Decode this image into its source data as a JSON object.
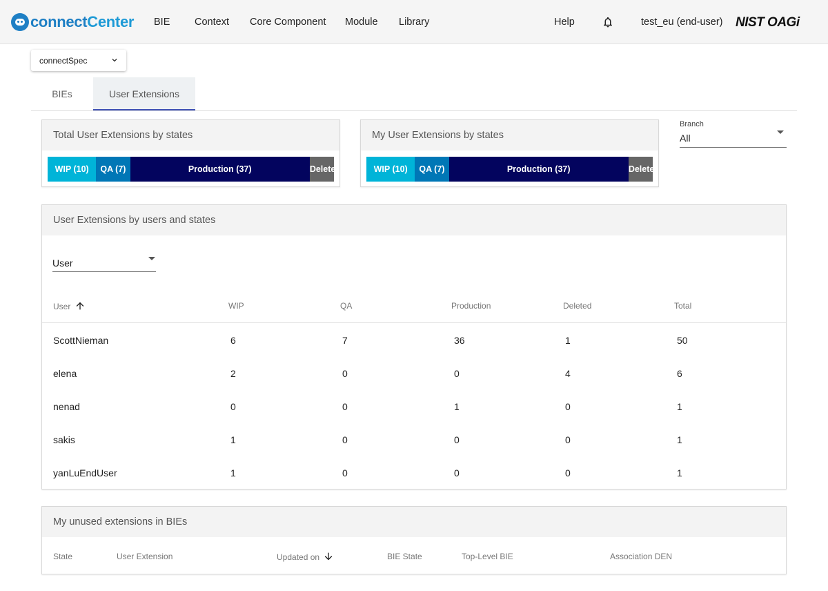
{
  "brand": {
    "part1": "connect",
    "part2": "Center"
  },
  "nav": {
    "items": [
      "BIE",
      "Context",
      "Core Component",
      "Module",
      "Library"
    ],
    "help": "Help",
    "user": "test_eu (end-user)",
    "org_logo": "NIST OAGi"
  },
  "spec_select": {
    "value": "connectSpec"
  },
  "tabs": [
    {
      "label": "BIEs",
      "active": false
    },
    {
      "label": "User Extensions",
      "active": true
    }
  ],
  "total_card": {
    "title": "Total User Extensions by states",
    "segments": [
      {
        "label": "WIP (10)",
        "value": 10,
        "color": "#00b4d8"
      },
      {
        "label": "QA (7)",
        "value": 7,
        "color": "#0077b6"
      },
      {
        "label": "Production (37)",
        "value": 37,
        "color": "#03045e"
      },
      {
        "label": "Deleted",
        "value": 5,
        "color": "#666666"
      }
    ]
  },
  "my_card": {
    "title": "My User Extensions by states",
    "segments": [
      {
        "label": "WIP (10)",
        "value": 10,
        "color": "#00b4d8"
      },
      {
        "label": "QA (7)",
        "value": 7,
        "color": "#0077b6"
      },
      {
        "label": "Production (37)",
        "value": 37,
        "color": "#03045e"
      },
      {
        "label": "Deleted",
        "value": 5,
        "color": "#666666"
      }
    ]
  },
  "branch": {
    "label": "Branch",
    "value": "All"
  },
  "users_card": {
    "title": "User Extensions by users and states",
    "filter_value": "User",
    "columns": [
      "User",
      "WIP",
      "QA",
      "Production",
      "Deleted",
      "Total"
    ],
    "rows": [
      [
        "ScottNieman",
        "6",
        "7",
        "36",
        "1",
        "50"
      ],
      [
        "elena",
        "2",
        "0",
        "0",
        "4",
        "6"
      ],
      [
        "nenad",
        "0",
        "0",
        "1",
        "0",
        "1"
      ],
      [
        "sakis",
        "1",
        "0",
        "0",
        "0",
        "1"
      ],
      [
        "yanLuEndUser",
        "1",
        "0",
        "0",
        "0",
        "1"
      ]
    ]
  },
  "unused_card": {
    "title": "My unused extensions in BIEs",
    "columns": [
      "State",
      "User Extension",
      "Updated on",
      "BIE State",
      "Top-Level BIE",
      "Association DEN"
    ]
  }
}
